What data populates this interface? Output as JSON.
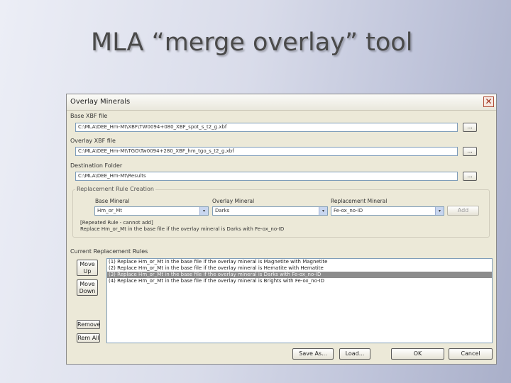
{
  "slide": {
    "title": "MLA “merge overlay” tool"
  },
  "window": {
    "title": "Overlay Minerals",
    "close_glyph": "✕",
    "base_xbf": {
      "label": "Base XBF file",
      "value": "C:\\MLA\\DEE_Hm-Mt\\XBF\\TW0094+080_XBF_spot_s_t2_g.xbf",
      "browse": "..."
    },
    "overlay_xbf": {
      "label": "Overlay XBF file",
      "value": "C:\\MLA\\DEE_Hm-Mt\\TGO\\Tw0094+280_XBF_hm_tgo_s_t2_g.xbf",
      "browse": "..."
    },
    "destination": {
      "label": "Destination Folder",
      "value": "C:\\MLA\\DEE_Hm-Mt\\Results",
      "browse": "..."
    },
    "rule_creation": {
      "group_title": "Replacement Rule Creation",
      "base_label": "Base Mineral",
      "overlay_label": "Overlay Mineral",
      "replacement_label": "Replacement Mineral",
      "base_value": "Hm_or_Mt",
      "overlay_value": "Darks",
      "replacement_value": "Fe-ox_no-ID",
      "add_label": "Add",
      "arrow_glyph": "▾",
      "description_line1": "[Repeated Rule - cannot add]",
      "description_line2": "Replace Hm_or_Mt in the base file if the overlay mineral is Darks with Fe-ox_no-ID"
    },
    "current_rules": {
      "label": "Current Replacement Rules",
      "items": [
        {
          "text": "(1) Replace Hm_or_Mt in the base file if the overlay mineral is Magnetite with Magnetite",
          "selected": false
        },
        {
          "text": "(2) Replace Hm_or_Mt in the base file if the overlay mineral is Hematite with Hematite",
          "selected": false
        },
        {
          "text": "(3) Replace Hm_or_Mt in the base file if the overlay mineral is Darks with Fe-ox_no-ID",
          "selected": true
        },
        {
          "text": "(4) Replace Hm_or_Mt in the base file if the overlay mineral is Brights with Fe-ox_no-ID",
          "selected": false
        }
      ],
      "move_up_line1": "Move",
      "move_up_line2": "Up",
      "move_down_line1": "Move",
      "move_down_line2": "Down",
      "remove": "Remove",
      "rem_all": "Rem All"
    },
    "footer": {
      "save": "Save As...",
      "load": "Load...",
      "ok": "OK",
      "cancel": "Cancel"
    }
  }
}
